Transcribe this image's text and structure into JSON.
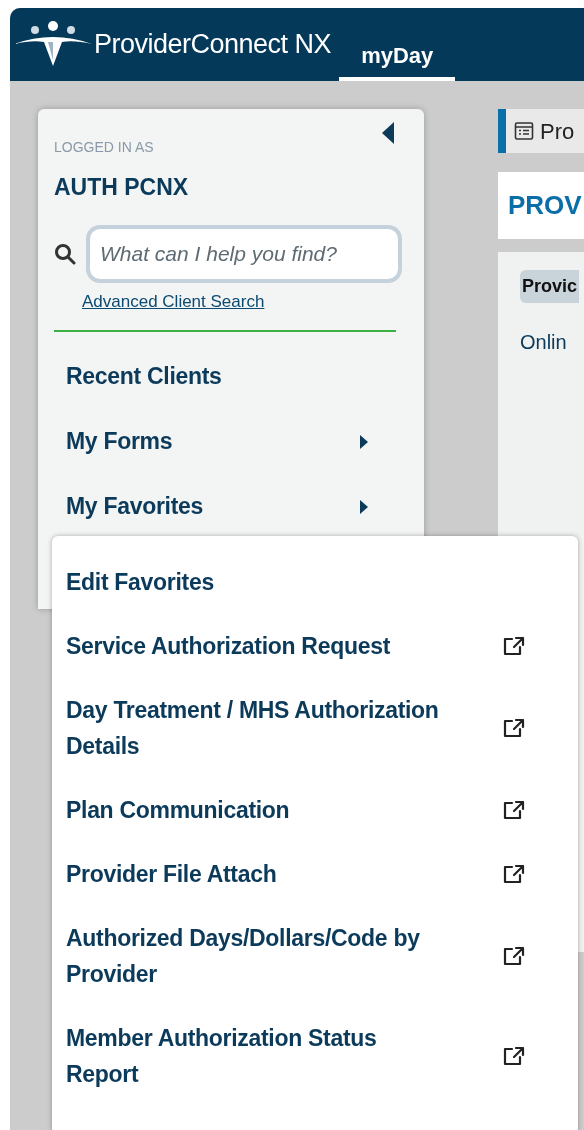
{
  "header": {
    "app_name": "ProviderConnect NX",
    "tabs": [
      {
        "label": "myDay",
        "selected": true
      }
    ]
  },
  "sidebar": {
    "logged_in_label": "LOGGED IN AS",
    "user": "AUTH PCNX",
    "search": {
      "placeholder": "What can I help you find?"
    },
    "advanced_link": "Advanced Client Search",
    "items": [
      {
        "label": "Recent Clients",
        "submenu": false
      },
      {
        "label": "My Forms",
        "submenu": true
      },
      {
        "label": "My Favorites",
        "submenu": true
      }
    ]
  },
  "favorites_menu": [
    {
      "label": "Edit Favorites",
      "kind": "action"
    },
    {
      "label": "Service Authorization Request",
      "kind": "external"
    },
    {
      "label": "Day Treatment / MHS Authorization Details",
      "kind": "external"
    },
    {
      "label": "Plan Communication",
      "kind": "external"
    },
    {
      "label": "Provider File Attach",
      "kind": "external"
    },
    {
      "label": "Authorized Days/Dollars/Code by Provider",
      "kind": "external"
    },
    {
      "label": "Member Authorization Status Report",
      "kind": "external"
    }
  ],
  "content": {
    "tab": "Pro",
    "title": "PROV",
    "chip": "Provic",
    "text": "Onlin"
  }
}
